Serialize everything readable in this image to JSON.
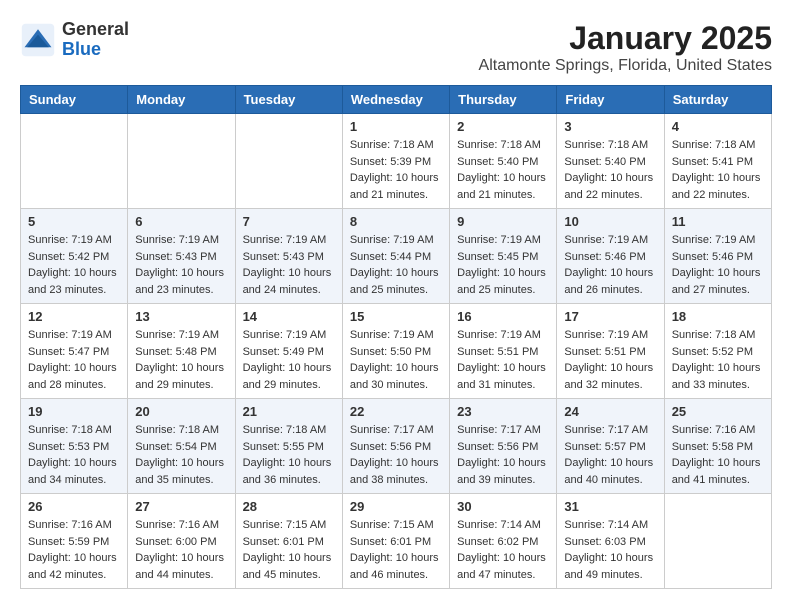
{
  "header": {
    "logo_general": "General",
    "logo_blue": "Blue",
    "title": "January 2025",
    "subtitle": "Altamonte Springs, Florida, United States"
  },
  "weekdays": [
    "Sunday",
    "Monday",
    "Tuesday",
    "Wednesday",
    "Thursday",
    "Friday",
    "Saturday"
  ],
  "weeks": [
    [
      {
        "day": "",
        "sunrise": "",
        "sunset": "",
        "daylight": ""
      },
      {
        "day": "",
        "sunrise": "",
        "sunset": "",
        "daylight": ""
      },
      {
        "day": "",
        "sunrise": "",
        "sunset": "",
        "daylight": ""
      },
      {
        "day": "1",
        "sunrise": "Sunrise: 7:18 AM",
        "sunset": "Sunset: 5:39 PM",
        "daylight": "Daylight: 10 hours and 21 minutes."
      },
      {
        "day": "2",
        "sunrise": "Sunrise: 7:18 AM",
        "sunset": "Sunset: 5:40 PM",
        "daylight": "Daylight: 10 hours and 21 minutes."
      },
      {
        "day": "3",
        "sunrise": "Sunrise: 7:18 AM",
        "sunset": "Sunset: 5:40 PM",
        "daylight": "Daylight: 10 hours and 22 minutes."
      },
      {
        "day": "4",
        "sunrise": "Sunrise: 7:18 AM",
        "sunset": "Sunset: 5:41 PM",
        "daylight": "Daylight: 10 hours and 22 minutes."
      }
    ],
    [
      {
        "day": "5",
        "sunrise": "Sunrise: 7:19 AM",
        "sunset": "Sunset: 5:42 PM",
        "daylight": "Daylight: 10 hours and 23 minutes."
      },
      {
        "day": "6",
        "sunrise": "Sunrise: 7:19 AM",
        "sunset": "Sunset: 5:43 PM",
        "daylight": "Daylight: 10 hours and 23 minutes."
      },
      {
        "day": "7",
        "sunrise": "Sunrise: 7:19 AM",
        "sunset": "Sunset: 5:43 PM",
        "daylight": "Daylight: 10 hours and 24 minutes."
      },
      {
        "day": "8",
        "sunrise": "Sunrise: 7:19 AM",
        "sunset": "Sunset: 5:44 PM",
        "daylight": "Daylight: 10 hours and 25 minutes."
      },
      {
        "day": "9",
        "sunrise": "Sunrise: 7:19 AM",
        "sunset": "Sunset: 5:45 PM",
        "daylight": "Daylight: 10 hours and 25 minutes."
      },
      {
        "day": "10",
        "sunrise": "Sunrise: 7:19 AM",
        "sunset": "Sunset: 5:46 PM",
        "daylight": "Daylight: 10 hours and 26 minutes."
      },
      {
        "day": "11",
        "sunrise": "Sunrise: 7:19 AM",
        "sunset": "Sunset: 5:46 PM",
        "daylight": "Daylight: 10 hours and 27 minutes."
      }
    ],
    [
      {
        "day": "12",
        "sunrise": "Sunrise: 7:19 AM",
        "sunset": "Sunset: 5:47 PM",
        "daylight": "Daylight: 10 hours and 28 minutes."
      },
      {
        "day": "13",
        "sunrise": "Sunrise: 7:19 AM",
        "sunset": "Sunset: 5:48 PM",
        "daylight": "Daylight: 10 hours and 29 minutes."
      },
      {
        "day": "14",
        "sunrise": "Sunrise: 7:19 AM",
        "sunset": "Sunset: 5:49 PM",
        "daylight": "Daylight: 10 hours and 29 minutes."
      },
      {
        "day": "15",
        "sunrise": "Sunrise: 7:19 AM",
        "sunset": "Sunset: 5:50 PM",
        "daylight": "Daylight: 10 hours and 30 minutes."
      },
      {
        "day": "16",
        "sunrise": "Sunrise: 7:19 AM",
        "sunset": "Sunset: 5:51 PM",
        "daylight": "Daylight: 10 hours and 31 minutes."
      },
      {
        "day": "17",
        "sunrise": "Sunrise: 7:19 AM",
        "sunset": "Sunset: 5:51 PM",
        "daylight": "Daylight: 10 hours and 32 minutes."
      },
      {
        "day": "18",
        "sunrise": "Sunrise: 7:18 AM",
        "sunset": "Sunset: 5:52 PM",
        "daylight": "Daylight: 10 hours and 33 minutes."
      }
    ],
    [
      {
        "day": "19",
        "sunrise": "Sunrise: 7:18 AM",
        "sunset": "Sunset: 5:53 PM",
        "daylight": "Daylight: 10 hours and 34 minutes."
      },
      {
        "day": "20",
        "sunrise": "Sunrise: 7:18 AM",
        "sunset": "Sunset: 5:54 PM",
        "daylight": "Daylight: 10 hours and 35 minutes."
      },
      {
        "day": "21",
        "sunrise": "Sunrise: 7:18 AM",
        "sunset": "Sunset: 5:55 PM",
        "daylight": "Daylight: 10 hours and 36 minutes."
      },
      {
        "day": "22",
        "sunrise": "Sunrise: 7:17 AM",
        "sunset": "Sunset: 5:56 PM",
        "daylight": "Daylight: 10 hours and 38 minutes."
      },
      {
        "day": "23",
        "sunrise": "Sunrise: 7:17 AM",
        "sunset": "Sunset: 5:56 PM",
        "daylight": "Daylight: 10 hours and 39 minutes."
      },
      {
        "day": "24",
        "sunrise": "Sunrise: 7:17 AM",
        "sunset": "Sunset: 5:57 PM",
        "daylight": "Daylight: 10 hours and 40 minutes."
      },
      {
        "day": "25",
        "sunrise": "Sunrise: 7:16 AM",
        "sunset": "Sunset: 5:58 PM",
        "daylight": "Daylight: 10 hours and 41 minutes."
      }
    ],
    [
      {
        "day": "26",
        "sunrise": "Sunrise: 7:16 AM",
        "sunset": "Sunset: 5:59 PM",
        "daylight": "Daylight: 10 hours and 42 minutes."
      },
      {
        "day": "27",
        "sunrise": "Sunrise: 7:16 AM",
        "sunset": "Sunset: 6:00 PM",
        "daylight": "Daylight: 10 hours and 44 minutes."
      },
      {
        "day": "28",
        "sunrise": "Sunrise: 7:15 AM",
        "sunset": "Sunset: 6:01 PM",
        "daylight": "Daylight: 10 hours and 45 minutes."
      },
      {
        "day": "29",
        "sunrise": "Sunrise: 7:15 AM",
        "sunset": "Sunset: 6:01 PM",
        "daylight": "Daylight: 10 hours and 46 minutes."
      },
      {
        "day": "30",
        "sunrise": "Sunrise: 7:14 AM",
        "sunset": "Sunset: 6:02 PM",
        "daylight": "Daylight: 10 hours and 47 minutes."
      },
      {
        "day": "31",
        "sunrise": "Sunrise: 7:14 AM",
        "sunset": "Sunset: 6:03 PM",
        "daylight": "Daylight: 10 hours and 49 minutes."
      },
      {
        "day": "",
        "sunrise": "",
        "sunset": "",
        "daylight": ""
      }
    ]
  ]
}
